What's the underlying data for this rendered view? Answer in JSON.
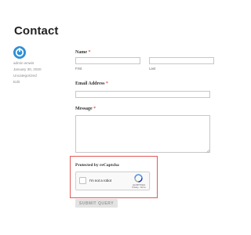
{
  "page": {
    "title": "Contact"
  },
  "meta": {
    "author": "admin wnwis",
    "date": "January 30, 2020",
    "category": "Uncategorized",
    "edit": "Edit"
  },
  "form": {
    "name_label": "Name",
    "required_marker": "*",
    "first_sublabel": "First",
    "last_sublabel": "Last",
    "first_value": "",
    "last_value": "",
    "email_label": "Email Address",
    "email_value": "",
    "message_label": "Message",
    "message_value": "",
    "recaptcha_title": "Protected by reCaptcha",
    "submit_label": "SUBMIT QUERY"
  },
  "recaptcha": {
    "checkbox_label": "I'm not a robot",
    "brand": "reCAPTCHA",
    "links": "Privacy - Terms",
    "checked": false
  },
  "colors": {
    "highlight_border": "#e15a5a",
    "required": "#d9534f",
    "avatar": "#2e8fd6"
  },
  "icons": {
    "avatar": "wordpress-power-logo-icon",
    "recaptcha": "recaptcha-logo-icon",
    "resize": "resize-grip-icon"
  }
}
